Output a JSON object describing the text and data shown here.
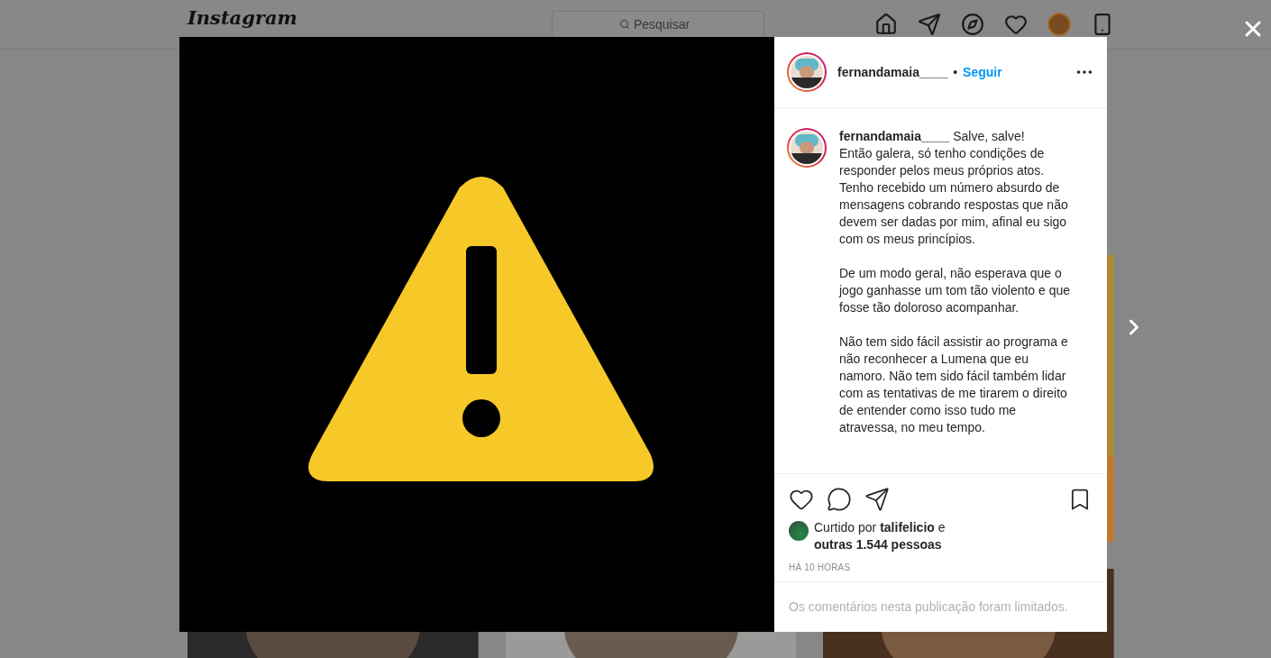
{
  "header": {
    "logo": "Instagram",
    "search": {
      "placeholder": "Pesquisar"
    }
  },
  "post": {
    "author": {
      "username": "fernandamaia____",
      "separator": "•",
      "follow": "Seguir"
    },
    "caption": {
      "username": "fernandamaia____",
      "paragraphs": [
        "Salve, salve!\nEntão galera, só tenho condições de responder pelos meus próprios atos. Tenho recebido um número absurdo de mensagens cobrando respostas que não devem ser dadas por mim, afinal eu sigo com os meus princípios.",
        "De um modo geral, não esperava que o jogo ganhasse um tom tão violento e que fosse tão doloroso acompanhar.",
        "Não tem sido fácil assistir ao programa e não reconhecer a Lumena que eu namoro. Não tem sido fácil também lidar com as tentativas de me tirarem o direito de entender como isso tudo me atravessa, no meu tempo."
      ]
    },
    "likes": "Curtido por **talifelicio** e **outras 1.544 pessoas**",
    "time": "HÁ 10 HORAS",
    "comments_notice": "Os comentários nesta publicação foram limitados."
  }
}
